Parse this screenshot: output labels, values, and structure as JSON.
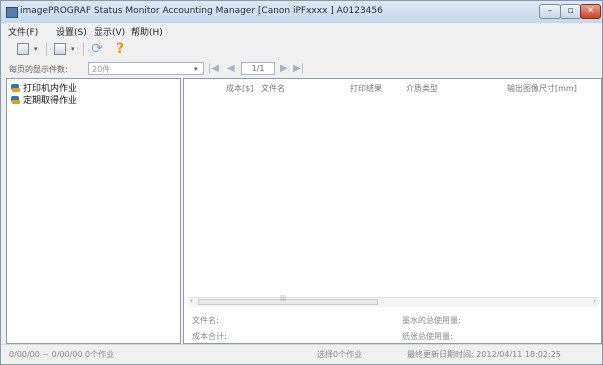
{
  "window": {
    "title": "imagePROGRAF Status Monitor Accounting Manager [Canon iPFxxxx ]  A0123456",
    "min_glyph": "–",
    "max_glyph": "▫",
    "close_glyph": "✕"
  },
  "menu": [
    {
      "label": "文件(F)"
    },
    {
      "label": "设置(S)"
    },
    {
      "label": "显示(V)"
    },
    {
      "label": "帮助(H)"
    }
  ],
  "toolbar": {
    "icons": [
      "print-job-icon",
      "properties-icon",
      "refresh-icon",
      "help-icon"
    ],
    "dropdown_glyph": "▾",
    "refresh_glyph": "⟳",
    "help_glyph": "?"
  },
  "pager": {
    "label": "每页的显示件数:",
    "per_page_value": "20件",
    "page_value": "1/1",
    "first_glyph": "|◀",
    "prev_glyph": "◀",
    "next_glyph": "▶",
    "last_glyph": "▶|"
  },
  "tree": {
    "items": [
      {
        "label": "打印机内作业"
      },
      {
        "label": "定期取得作业"
      }
    ]
  },
  "table": {
    "columns": [
      "成本[$]",
      "文件名",
      "打印结果",
      "介质类型",
      "输出图像尺寸[mm]"
    ],
    "rows": []
  },
  "scroll": {
    "left_glyph": "‹",
    "right_glyph": "›",
    "grip": "|||"
  },
  "details": {
    "file_name_label": "文件名:",
    "total_cost_label": "成本合计:",
    "ink_usage_label": "墨水的总使用量:",
    "paper_usage_label": "纸张总使用量:"
  },
  "status": {
    "date_range": "0/00/00 ~ 0/00/00  0个作业",
    "selected": "选择0个作业",
    "last_updated": "最终更新日期时间: 2012/04/11 18:02:25"
  }
}
